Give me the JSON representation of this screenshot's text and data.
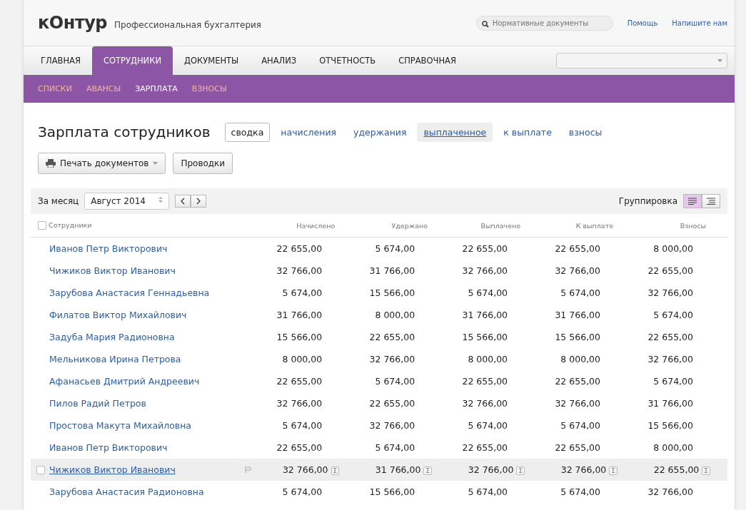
{
  "header": {
    "logo": "кОнтур",
    "subtitle": "Профессиональная бухгалтерия",
    "search": {
      "placeholder": "Нормативные документы"
    },
    "links": [
      "Помощь",
      "Напишите нам"
    ]
  },
  "nav": {
    "tabs": [
      {
        "label": "ГЛАВНАЯ",
        "selected": false
      },
      {
        "label": "СОТРУДНИКИ",
        "selected": true
      },
      {
        "label": "ДОКУМЕНТЫ",
        "selected": false
      },
      {
        "label": "АНАЛИЗ",
        "selected": false
      },
      {
        "label": "ОТЧЕТНОСТЬ",
        "selected": false
      },
      {
        "label": "СПРАВОЧНАЯ",
        "selected": false
      }
    ]
  },
  "subnav": [
    {
      "label": "СПИСКИ",
      "selected": false
    },
    {
      "label": "АВАНСЫ",
      "selected": false
    },
    {
      "label": "ЗАРПЛАТА",
      "selected": true
    },
    {
      "label": "ВЗНОСЫ",
      "selected": false
    }
  ],
  "page_title": "Зарплата сотрудников",
  "views": [
    {
      "label": "сводка",
      "selected": true,
      "hovered": false
    },
    {
      "label": "начисления",
      "selected": false,
      "hovered": false
    },
    {
      "label": "удержания",
      "selected": false,
      "hovered": false
    },
    {
      "label": "выплаченное",
      "selected": false,
      "hovered": true
    },
    {
      "label": "к выплате",
      "selected": false,
      "hovered": false
    },
    {
      "label": "взносы",
      "selected": false,
      "hovered": false
    }
  ],
  "actions": [
    {
      "label": "Печать документов",
      "kind": "print"
    },
    {
      "label": "Проводки",
      "kind": "plain"
    }
  ],
  "toolbar": {
    "period_label": "За месяц",
    "period": "Август 2014",
    "grouping_label": "Группировка",
    "grouping": [
      {
        "kind": "flat",
        "selected": true
      },
      {
        "kind": "tree",
        "selected": false
      }
    ]
  },
  "table": {
    "select_all": {
      "checked": false
    },
    "sum_button_labels": [
      "Σ",
      "Σ",
      "Σ",
      "Σ",
      "Σ"
    ],
    "columns": [
      "Сотрудники",
      "Начислено",
      "Удержано",
      "Выплачено",
      "К выплате",
      "Взносы"
    ],
    "rows": [
      {
        "name": "Иванов Петр Викторович",
        "values": [
          "22 655,00",
          "5 674,00",
          "22 655,00",
          "22 655,00",
          "8 000,00"
        ],
        "hovered": false
      },
      {
        "name": "Чижиков Виктор Иванович",
        "values": [
          "32 766,00",
          "31 766,00",
          "32 766,00",
          "32 766,00",
          "22 655,00"
        ],
        "hovered": false
      },
      {
        "name": "Зарубова Анастасия Геннадьевна",
        "values": [
          "5 674,00",
          "15 566,00",
          "5 674,00",
          "5 674,00",
          "32 766,00"
        ],
        "hovered": false
      },
      {
        "name": "Филатов Виктор Михайлович",
        "values": [
          "31 766,00",
          "8 000,00",
          "31 766,00",
          "31 766,00",
          "5 674,00"
        ],
        "hovered": false
      },
      {
        "name": "Задуба Мария Радионовна",
        "values": [
          "15 566,00",
          "22 655,00",
          "15 566,00",
          "15 566,00",
          "22 655,00"
        ],
        "hovered": false
      },
      {
        "name": "Мельникова Ирина Петрова",
        "values": [
          "8 000,00",
          "32 766,00",
          "8 000,00",
          "8 000,00",
          "32 766,00"
        ],
        "hovered": false
      },
      {
        "name": "Афанасьев Дмитрий Андреевич",
        "values": [
          "22 655,00",
          "5 674,00",
          "22 655,00",
          "22 655,00",
          "5 674,00"
        ],
        "hovered": false
      },
      {
        "name": "Пилов Радий Петров",
        "values": [
          "32 766,00",
          "22 655,00",
          "32 766,00",
          "32 766,00",
          "31 766,00"
        ],
        "hovered": false
      },
      {
        "name": "Простова Макута Михайловна",
        "values": [
          "5 674,00",
          "32 766,00",
          "5 674,00",
          "5 674,00",
          "15 566,00"
        ],
        "hovered": false
      },
      {
        "name": "Иванов Петр Викторович",
        "values": [
          "22 655,00",
          "5 674,00",
          "22 655,00",
          "22 655,00",
          "8 000,00"
        ],
        "hovered": false
      },
      {
        "name": "Чижиков Виктор Иванович",
        "values": [
          "32 766,00",
          "31 766,00",
          "32 766,00",
          "32 766,00",
          "22 655,00"
        ],
        "hovered": true
      },
      {
        "name": "Зарубова Анастасия Радионовна",
        "values": [
          "5 674,00",
          "15 566,00",
          "5 674,00",
          "5 674,00",
          "32 766,00"
        ],
        "hovered": false
      }
    ]
  }
}
